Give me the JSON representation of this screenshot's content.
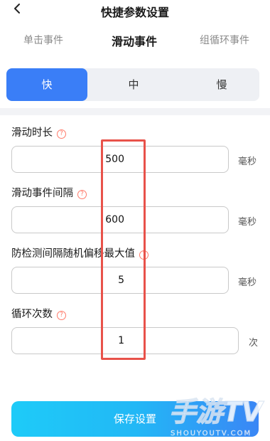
{
  "header": {
    "title": "快捷参数设置"
  },
  "tabs": [
    {
      "label": "单击事件"
    },
    {
      "label": "滑动事件"
    },
    {
      "label": "组循环事件"
    }
  ],
  "speed": [
    {
      "label": "快"
    },
    {
      "label": "中"
    },
    {
      "label": "慢"
    }
  ],
  "fields": [
    {
      "label": "滑动时长",
      "value": "500",
      "unit": "毫秒"
    },
    {
      "label": "滑动事件间隔",
      "value": "600",
      "unit": "毫秒"
    },
    {
      "label": "防检测间隔随机偏移最大值",
      "value": "5",
      "unit": "毫秒"
    },
    {
      "label": "循环次数",
      "value": "1",
      "unit": "次"
    }
  ],
  "save_label": "保存设置",
  "watermark": {
    "brand": "手游TV",
    "sub": "SHOUYOUTV.COM"
  },
  "colors": {
    "accent": "#3a7ef7",
    "highlight": "#e8524a",
    "help": "#ff7b6b"
  }
}
